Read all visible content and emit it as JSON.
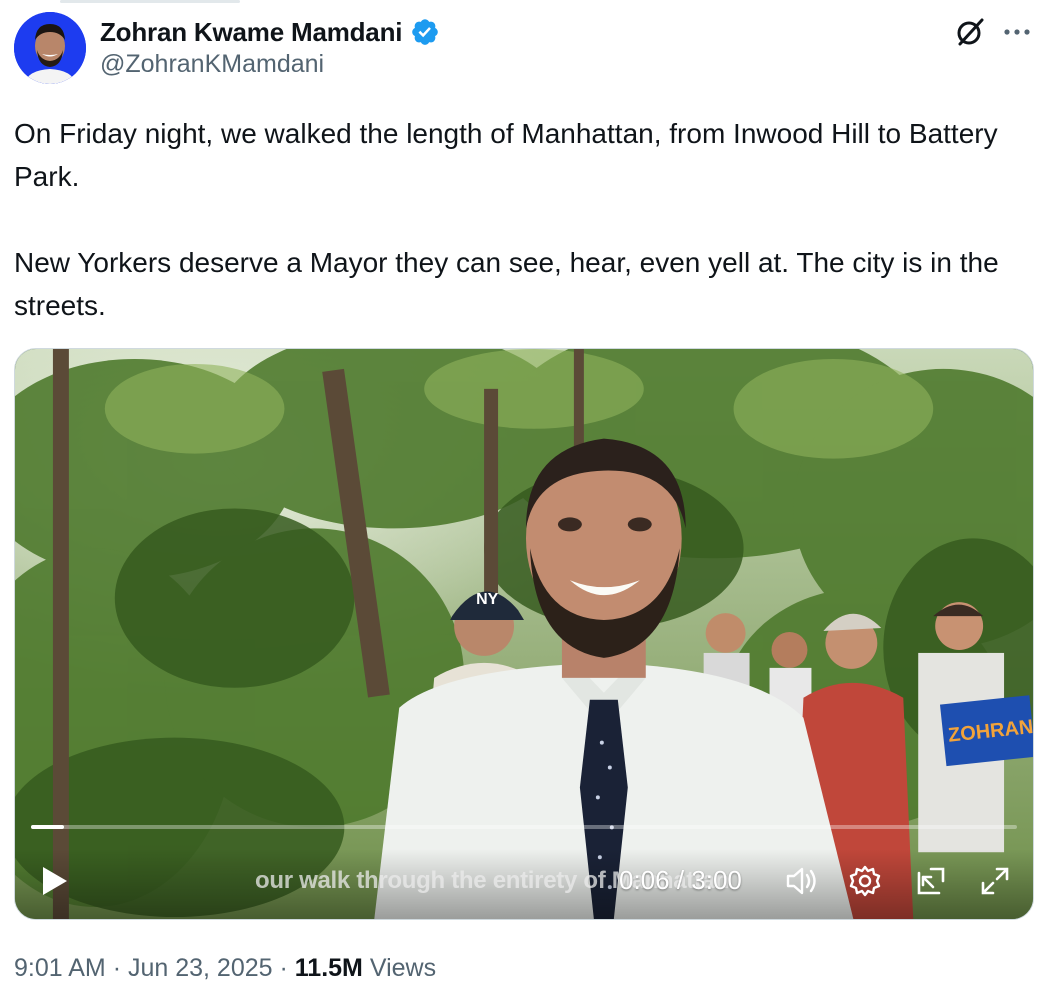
{
  "author": {
    "display_name": "Zohran Kwame Mamdani",
    "handle": "@ZohranKMamdani",
    "verified": true
  },
  "tweet": {
    "paragraphs": [
      "On Friday night, we walked the length of Manhattan, from Inwood Hill to Battery Park.",
      "New Yorkers deserve a Mayor they can see, hear, even yell at. The city is in the streets."
    ]
  },
  "video": {
    "caption": "our walk through the entirety of Manhattan",
    "time_display": "0:06 / 3:00",
    "progress_fraction": 0.033,
    "sign_text": "ZOHRAN",
    "cap_logo": "NY"
  },
  "meta": {
    "time": "9:01 AM",
    "separator": "·",
    "date": "Jun 23, 2025",
    "views_count": "11.5M",
    "views_label": "Views"
  },
  "icons": {
    "verified": "verified-badge-icon",
    "grok": "grok-icon",
    "more": "more-dots-icon",
    "play": "play-icon",
    "volume": "volume-icon",
    "settings": "gear-icon",
    "pip": "picture-in-picture-icon",
    "fullscreen": "fullscreen-icon"
  },
  "colors": {
    "verified_blue": "#1d9bf0",
    "secondary_text": "#536471",
    "primary_text": "#0f1419",
    "avatar_bg": "#1d3cf0"
  }
}
